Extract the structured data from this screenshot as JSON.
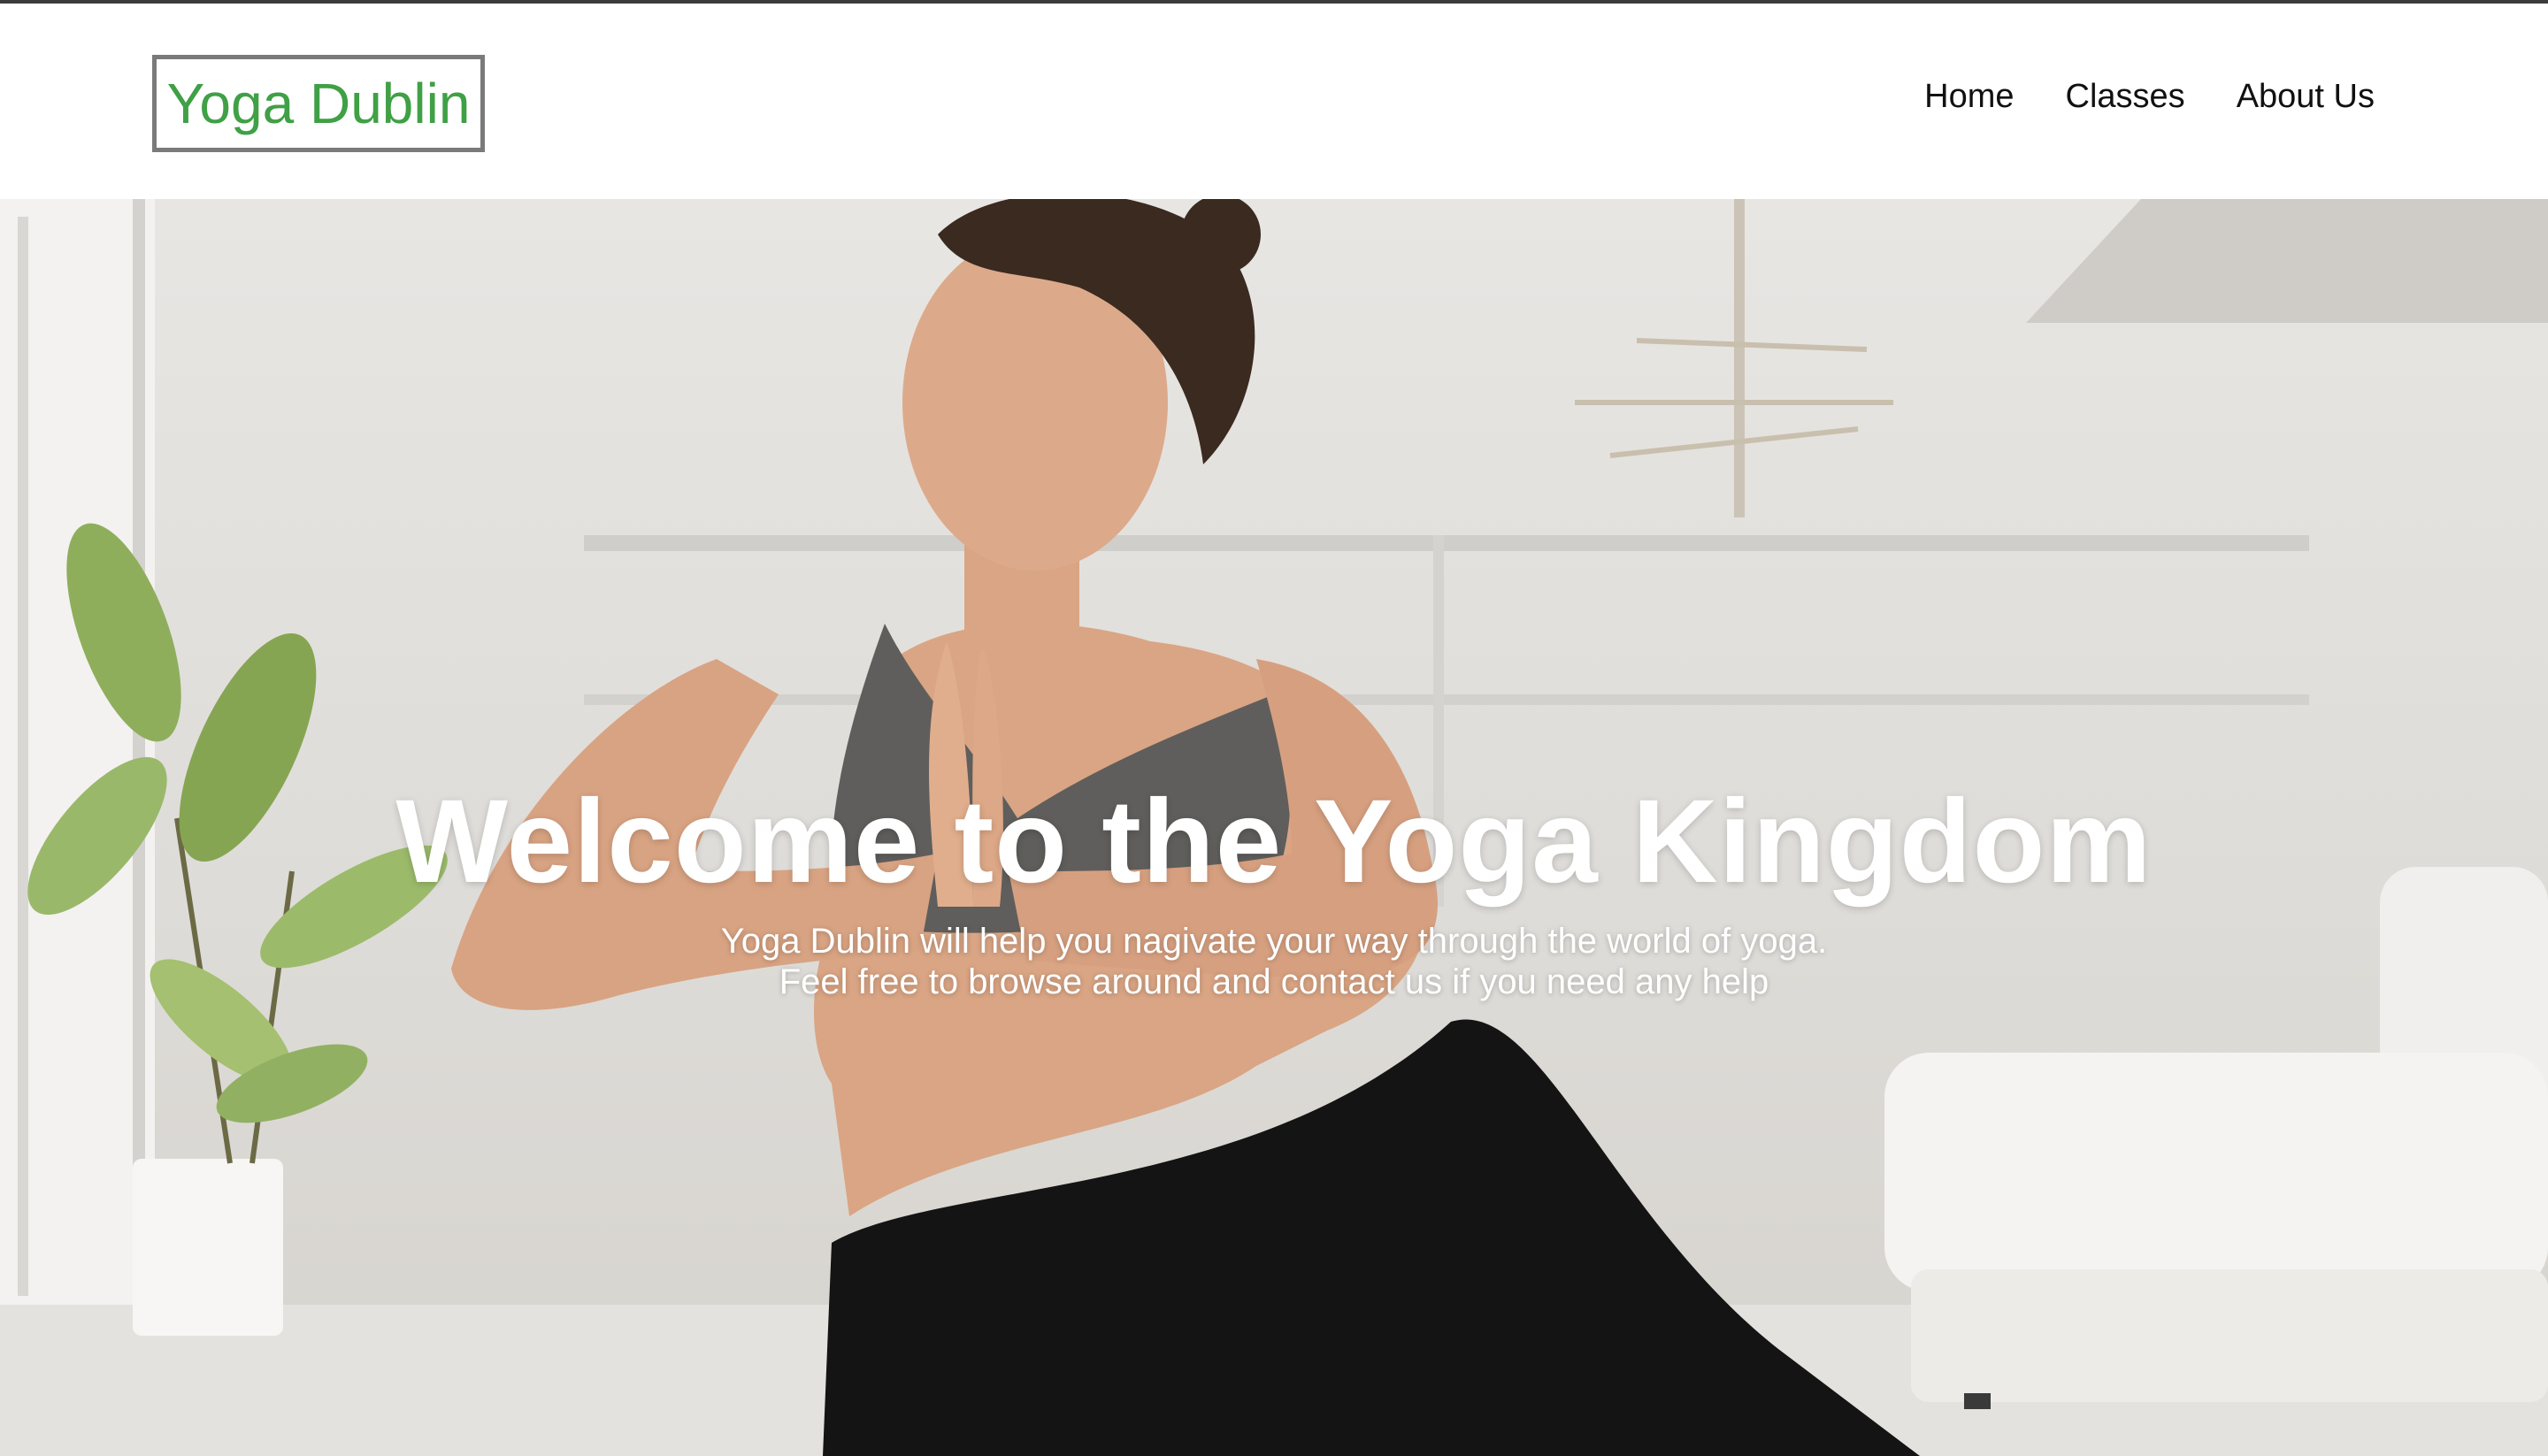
{
  "header": {
    "logo_text": "Yoga Dublin",
    "nav": [
      {
        "label": "Home"
      },
      {
        "label": "Classes"
      },
      {
        "label": "About Us"
      }
    ]
  },
  "hero": {
    "title": "Welcome to the Yoga Kingdom",
    "subtitle_line1": "Yoga Dublin will help you nagivate your way through the world of yoga.",
    "subtitle_line2": "Feel free to browse around and contact us if you need any help"
  },
  "colors": {
    "logo_green": "#3fa045",
    "logo_border": "#7a7a7a",
    "nav_text": "#111111",
    "hero_text": "#ffffff"
  }
}
